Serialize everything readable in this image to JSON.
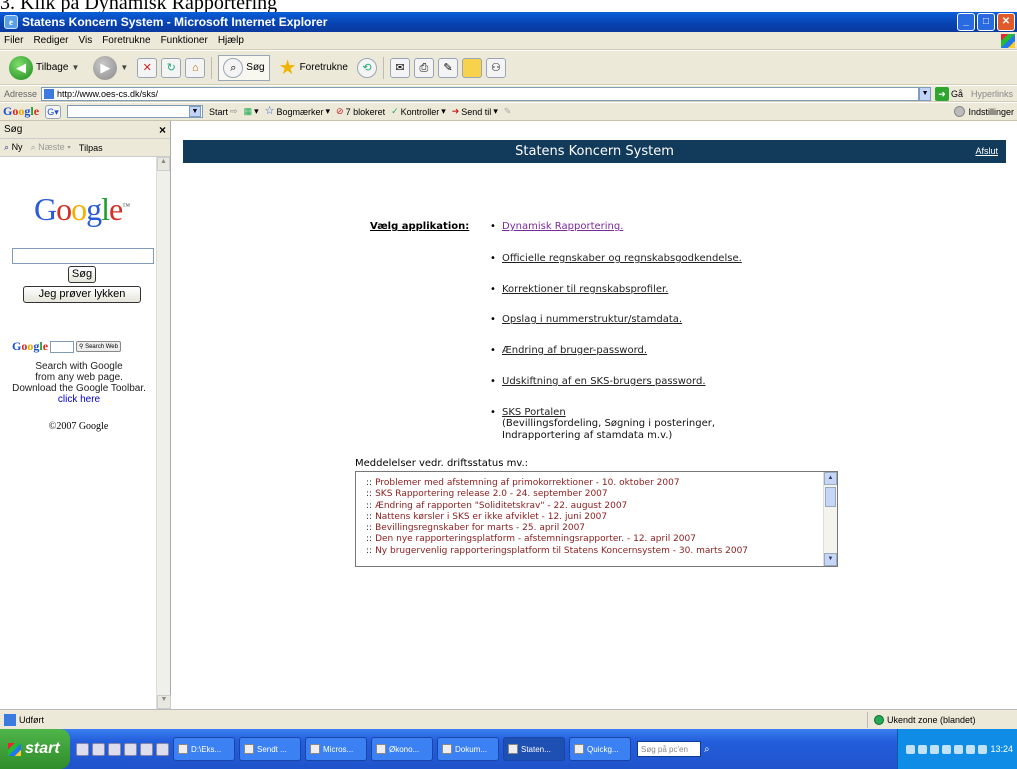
{
  "doc_caption": "3.   Klik på Dynamisk Rapportering",
  "window": {
    "title": "Statens Koncern System - Microsoft Internet Explorer",
    "min": "_",
    "max": "□",
    "close": "✕"
  },
  "menu": [
    "Filer",
    "Rediger",
    "Vis",
    "Foretrukne",
    "Funktioner",
    "Hjælp"
  ],
  "toolbar": {
    "back_label": "Tilbage",
    "search_label": "Søg",
    "favorites_label": "Foretrukne"
  },
  "address": {
    "label": "Adresse",
    "url": "http://www.oes-cs.dk/sks/",
    "go_label": "Gå",
    "links_label": "Hyperlinks"
  },
  "google_toolbar": {
    "logo": "Google",
    "items": [
      "Start",
      "Bogmærker",
      "7 blokeret",
      "Kontroller",
      "Send til"
    ],
    "settings": "Indstillinger"
  },
  "sidebar": {
    "title": "Søg",
    "close": "×",
    "new": "Ny",
    "next": "Næste",
    "customize": "Tilpas",
    "logo": "Google",
    "search_button": "Søg",
    "lucky_button": "Jeg prøver lykken",
    "search_web": "Search Web",
    "promo_lines": [
      "Search with Google",
      "from any web page.",
      "Download the Google Toolbar."
    ],
    "promo_link": "click here",
    "copyright": "©2007 Google"
  },
  "header": {
    "title": "Statens Koncern System",
    "logout": "Afslut"
  },
  "apps": {
    "label": "Vælg applikation:",
    "items": [
      {
        "label": "Dynamisk Rapportering."
      },
      {
        "label": "Officielle regnskaber og regnskabsgodkendelse."
      },
      {
        "label": "Korrektioner til regnskabsprofiler."
      },
      {
        "label": "Opslag i nummerstruktur/stamdata."
      },
      {
        "label": "Ændring af bruger-password."
      },
      {
        "label": "Udskiftning af en SKS-brugers password."
      },
      {
        "label": "SKS Portalen"
      }
    ],
    "portal_desc": [
      "(Bevillingsfordeling, Søgning i posteringer,",
      "Indrapportering af stamdata m.v.)"
    ]
  },
  "messages": {
    "label": "Meddelelser vedr. driftsstatus mv.:",
    "items": [
      "Problemer med afstemning af primokorrektioner - 10. oktober 2007",
      "SKS Rapportering release 2.0 - 24. september 2007",
      "Ændring af rapporten \"Soliditetskrav\" - 22. august 2007",
      "Nattens kørsler i SKS er ikke afviklet - 12. juni 2007",
      "Bevillingsregnskaber for marts - 25. april 2007",
      "Den nye rapporteringsplatform - afstemningsrapporter. - 12. april 2007",
      "Ny brugervenlig rapporteringsplatform til Statens Koncernsystem - 30. marts 2007"
    ]
  },
  "status": {
    "text": "Udført",
    "zone": "Ukendt zone (blandet)"
  },
  "taskbar": {
    "start": "start",
    "tasks": [
      "D:\\Eks...",
      "Sendt ...",
      "Micros...",
      "Økono...",
      "Dokum...",
      "Staten...",
      "Quickg..."
    ],
    "search_placeholder": "Søg på pc'en",
    "clock": "13:24"
  }
}
